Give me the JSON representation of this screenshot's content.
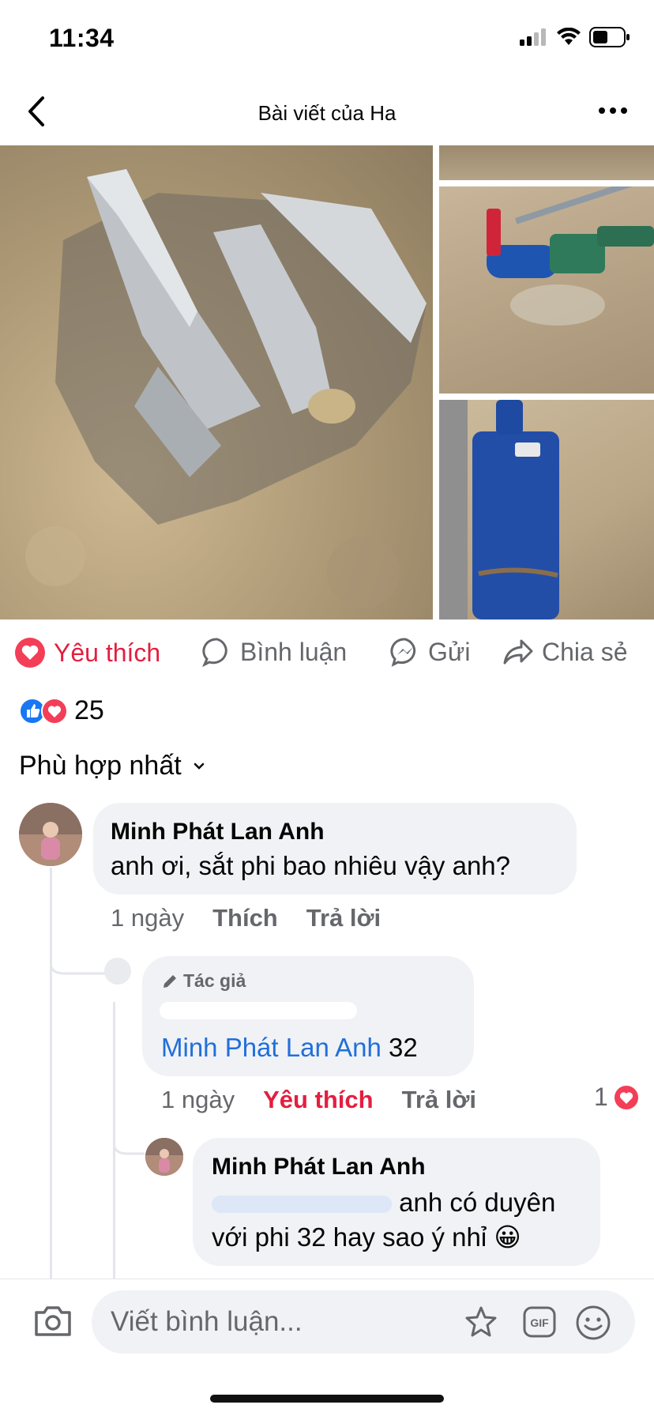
{
  "status": {
    "time": "11:34"
  },
  "nav": {
    "title": "Bài viết của Ha"
  },
  "actions": {
    "like": "Yêu thích",
    "comment": "Bình luận",
    "send": "Gửi",
    "share": "Chia sẻ"
  },
  "reactions": {
    "count": "25"
  },
  "sort": {
    "label": "Phù hợp nhất"
  },
  "comments": [
    {
      "author": "Minh Phát Lan Anh",
      "text": "anh ơi, sắt phi bao nhiêu vậy anh?",
      "time": "1 ngày",
      "like": "Thích",
      "reply": "Trả lời"
    },
    {
      "badge": "Tác giả",
      "mention": "Minh Phát Lan Anh",
      "text": " 32",
      "time": "1 ngày",
      "like": "Yêu thích",
      "reply": "Trả lời",
      "like_count": "1"
    },
    {
      "author": "Minh Phát Lan Anh",
      "line1": "anh có duyên",
      "line2": "với phi 32 hay sao ý nhỉ 😀"
    }
  ],
  "composer": {
    "placeholder": "Viết bình luận..."
  },
  "colors": {
    "like_red": "#e41e3f",
    "link_blue": "#216fdb",
    "bubble": "#f0f2f5",
    "meta_gray": "#65676b"
  },
  "icons": [
    "signal-icon",
    "wifi-icon",
    "battery-icon",
    "back-icon",
    "more-icon",
    "heart-icon",
    "comment-icon",
    "messenger-icon",
    "share-icon",
    "like-reaction-icon",
    "love-reaction-icon",
    "chevron-down-icon",
    "pencil-icon",
    "camera-icon",
    "sticker-icon",
    "gif-icon",
    "emoji-icon"
  ]
}
